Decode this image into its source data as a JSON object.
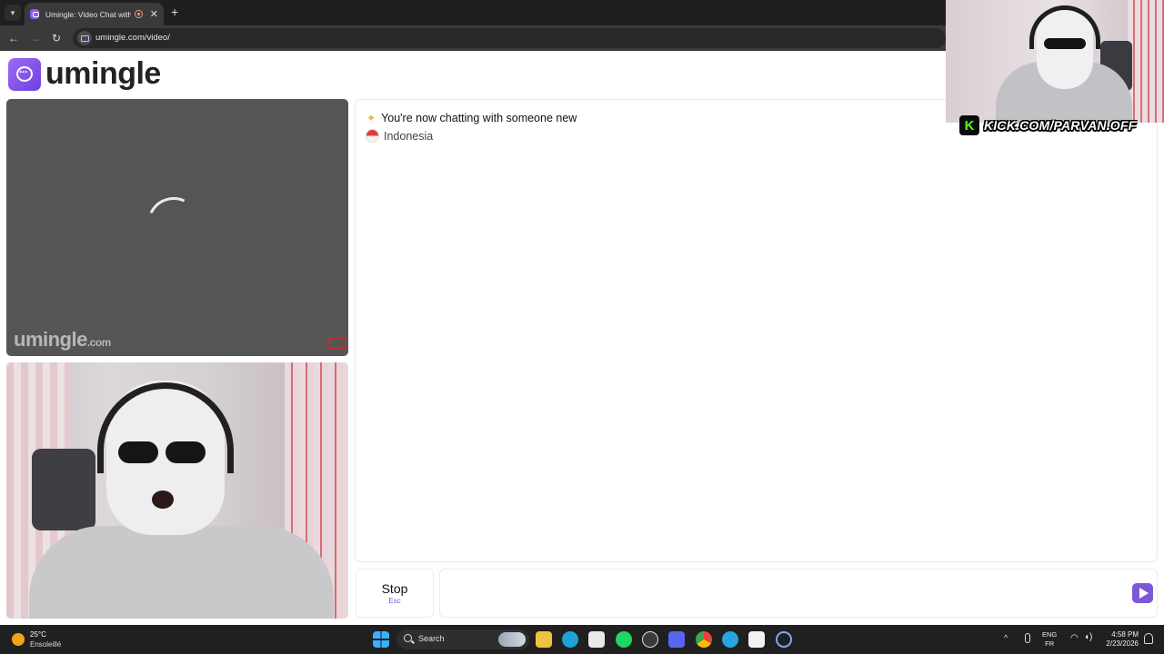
{
  "browser": {
    "tab_title": "Umingle: Video Chat with S",
    "url": "umingle.com/video/",
    "icons": [
      "tab-list-icon",
      "umingle-favicon",
      "recording-icon",
      "close-icon",
      "plus-icon",
      "back-arrow-icon",
      "forward-arrow-icon",
      "reload-icon",
      "site-info-icon"
    ]
  },
  "site": {
    "logo_text": "umingle",
    "accent_color": "#7e57d7"
  },
  "remote_video": {
    "watermark": "umingle",
    "watermark_suffix": ".com",
    "state": "loading"
  },
  "chat": {
    "system_message": "You're now chatting with someone new",
    "country": "Indonesia",
    "input_value": "",
    "stop_label": "Stop",
    "stop_shortcut": "Esc"
  },
  "overlay": {
    "kick_url": "KICK.COM/PARVAN.OFF",
    "kick_letter": "K",
    "kick_color": "#53fc18"
  },
  "taskbar": {
    "weather_temp": "25°C",
    "weather_desc": "Ensoleillé",
    "search_label": "Search",
    "lang_top": "ENG",
    "lang_bottom": "FR",
    "time": "4:58 PM",
    "date": "2/23/2026"
  }
}
